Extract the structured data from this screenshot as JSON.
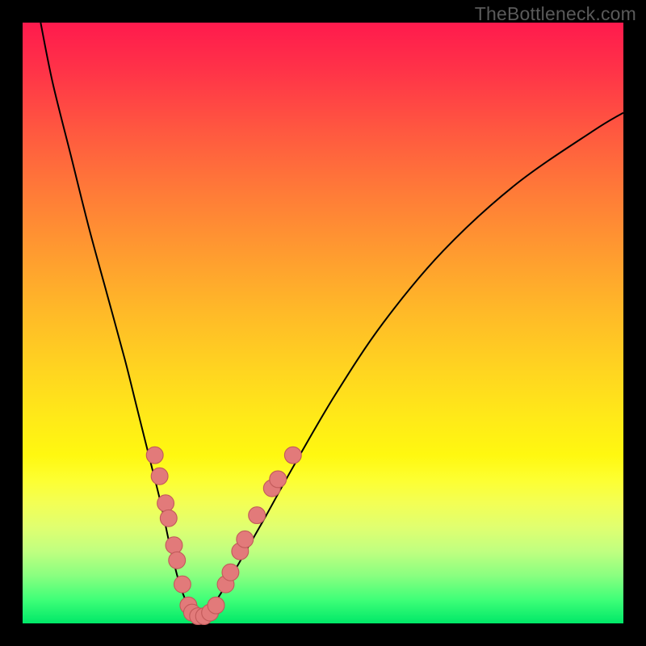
{
  "watermark_text": "TheBottleneck.com",
  "colors": {
    "frame": "#000000",
    "curve": "#000000",
    "dot_fill": "#e27a7a",
    "dot_stroke": "#c25a5a"
  },
  "chart_data": {
    "type": "line",
    "title": "",
    "xlabel": "",
    "ylabel": "",
    "xlim": [
      0,
      100
    ],
    "ylim": [
      0,
      100
    ],
    "note": "No axis ticks or numeric labels are rendered; values below are estimated from the geometry of the V-shaped curve in plot-fraction coordinates (0–100, origin bottom-left).",
    "series": [
      {
        "name": "bottleneck-curve",
        "x": [
          3,
          5,
          8,
          11,
          14,
          17,
          19,
          21,
          23,
          24.5,
          26,
          27.5,
          29,
          30,
          31,
          33,
          36,
          40,
          45,
          52,
          60,
          70,
          82,
          95,
          100
        ],
        "y": [
          100,
          90,
          78,
          66,
          55,
          44,
          36,
          28,
          20,
          13,
          7,
          3,
          0.5,
          0.5,
          2,
          5,
          10,
          17,
          26,
          38,
          50,
          62,
          73,
          82,
          85
        ]
      }
    ],
    "dots": {
      "name": "highlight-dots",
      "note": "Pink circular markers clustered near the curve minimum; coordinates in same 0–100 plot space.",
      "points": [
        {
          "x": 22.0,
          "y": 28.0
        },
        {
          "x": 22.8,
          "y": 24.5
        },
        {
          "x": 23.8,
          "y": 20.0
        },
        {
          "x": 24.3,
          "y": 17.5
        },
        {
          "x": 25.2,
          "y": 13.0
        },
        {
          "x": 25.7,
          "y": 10.5
        },
        {
          "x": 26.6,
          "y": 6.5
        },
        {
          "x": 27.6,
          "y": 3.0
        },
        {
          "x": 28.2,
          "y": 1.8
        },
        {
          "x": 29.2,
          "y": 1.2
        },
        {
          "x": 30.2,
          "y": 1.2
        },
        {
          "x": 31.2,
          "y": 1.8
        },
        {
          "x": 32.2,
          "y": 3.0
        },
        {
          "x": 33.8,
          "y": 6.5
        },
        {
          "x": 34.6,
          "y": 8.5
        },
        {
          "x": 36.2,
          "y": 12.0
        },
        {
          "x": 37.0,
          "y": 14.0
        },
        {
          "x": 39.0,
          "y": 18.0
        },
        {
          "x": 41.5,
          "y": 22.5
        },
        {
          "x": 42.5,
          "y": 24.0
        },
        {
          "x": 45.0,
          "y": 28.0
        }
      ],
      "radius": 1.4
    }
  }
}
